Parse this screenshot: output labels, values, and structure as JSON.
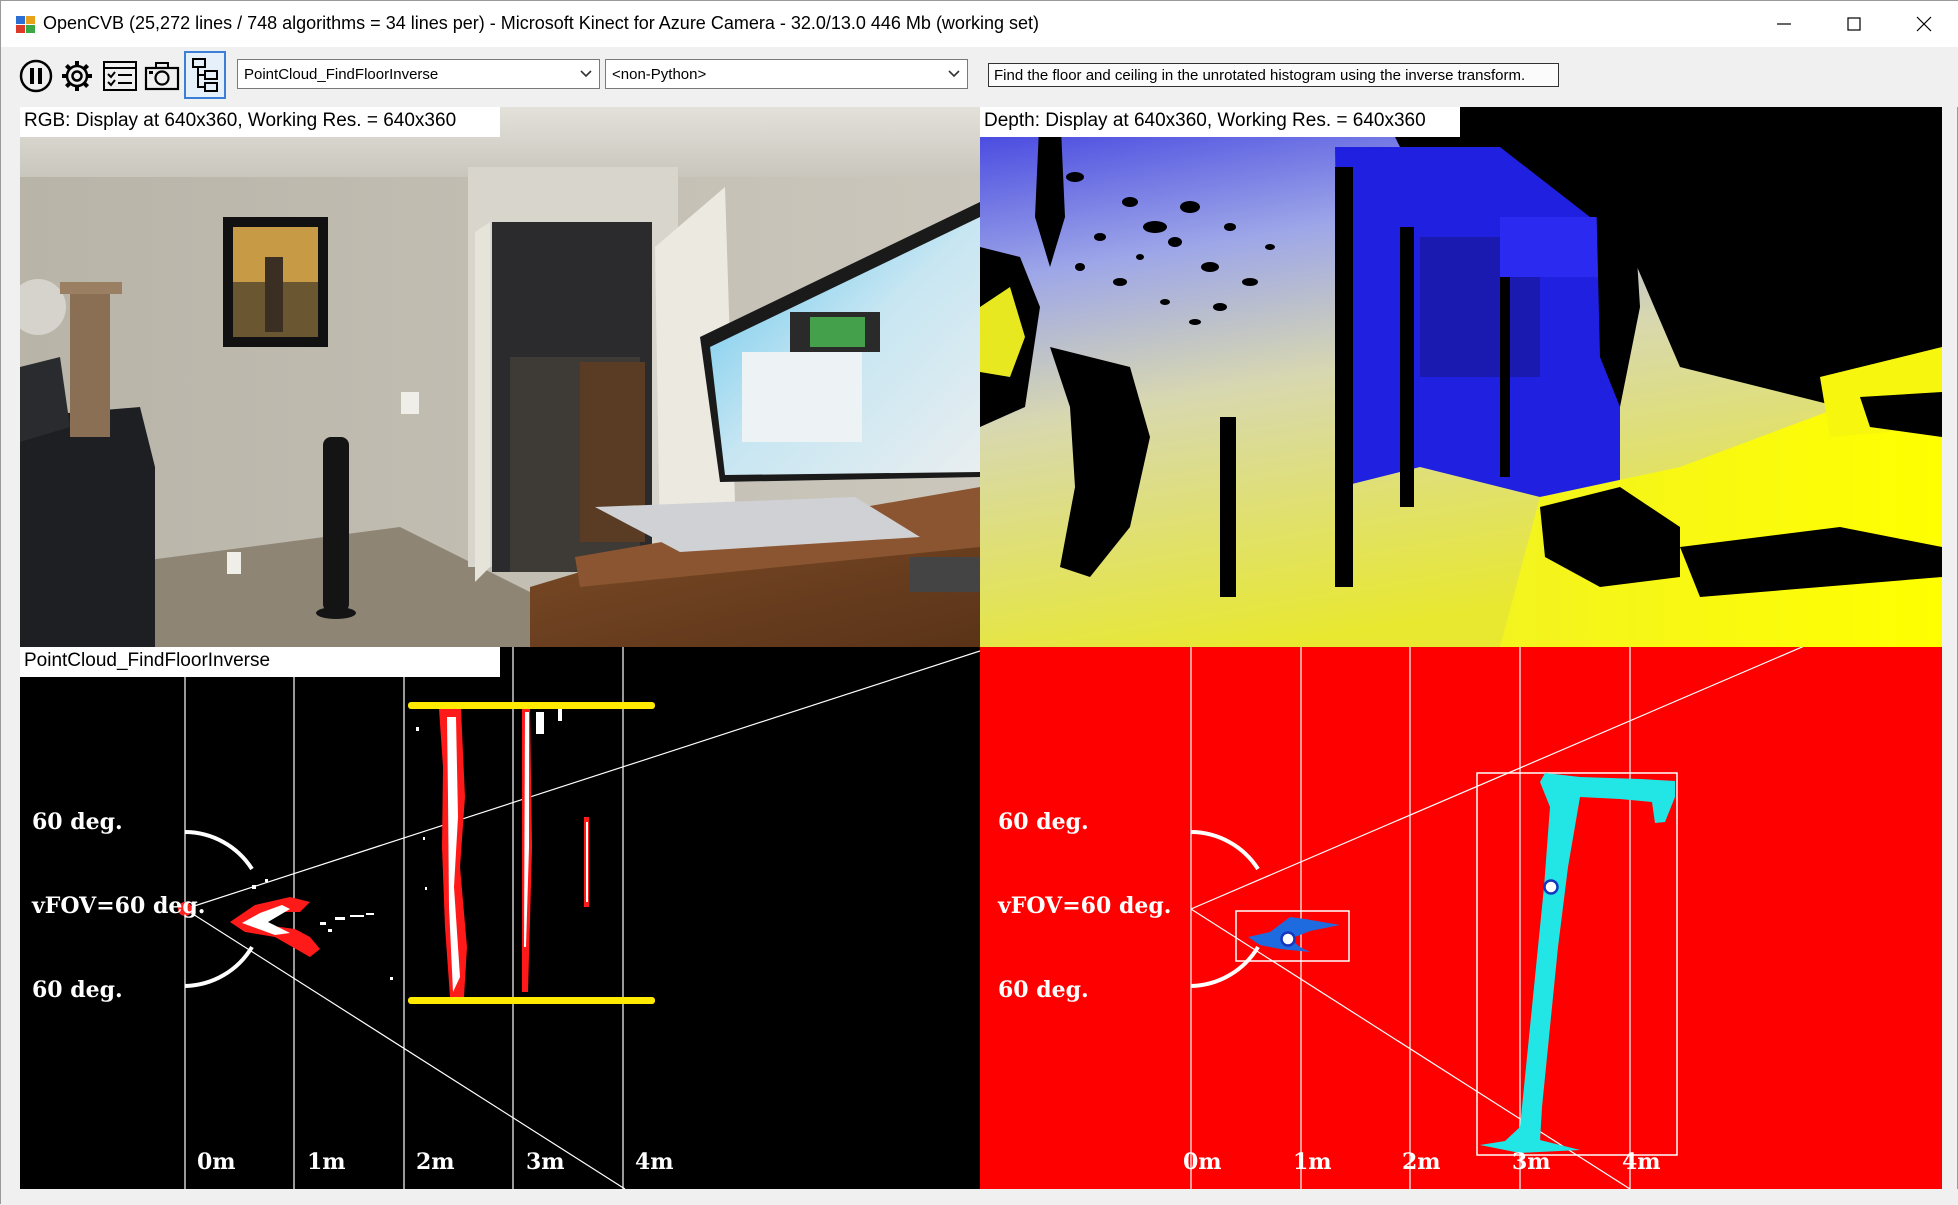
{
  "window": {
    "title": "OpenCVB (25,272 lines / 748 algorithms = 34 lines per) - Microsoft Kinect for Azure Camera - 32.0/13.0 446 Mb (working set)"
  },
  "toolbar": {
    "algorithm_selected": "PointCloud_FindFloorInverse",
    "python_selected": "<non-Python>",
    "description": "Find the floor and ceiling in the unrotated histogram using the inverse transform."
  },
  "panes": {
    "rgb_label": "RGB: Display at 640x360, Working Res. = 640x360",
    "depth_label": "Depth: Display at 640x360, Working Res. = 640x360",
    "cloud_label": "PointCloud_FindFloorInverse"
  },
  "overlay": {
    "angle_top": "60 deg.",
    "vfov": "vFOV=60 deg.",
    "angle_bottom": "60 deg.",
    "distance_labels": [
      "0m",
      "1m",
      "2m",
      "3m",
      "4m"
    ]
  },
  "colors": {
    "histogram_bg": "#ff0000",
    "floor_ceiling_line": "#ffea00",
    "cluster_cyan": "#22e6e6",
    "cluster_blue": "#1e6be0"
  }
}
